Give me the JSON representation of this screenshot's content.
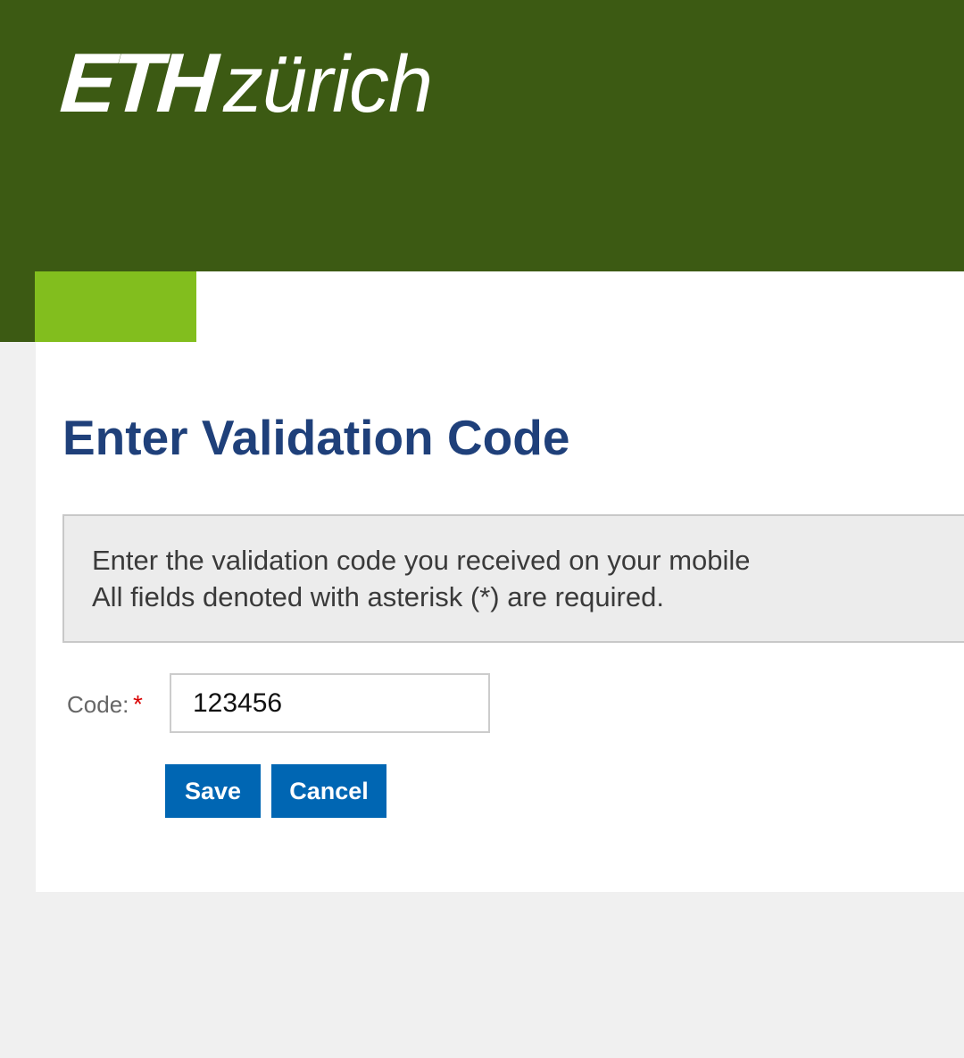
{
  "header": {
    "logo_eth": "ETH",
    "logo_zurich": "zürich",
    "background_color": "#3c5a13",
    "accent_color": "#82be1e"
  },
  "main": {
    "title": "Enter Validation Code",
    "info": {
      "line1": "Enter the validation code you received on your mobile",
      "line2": "All fields denoted with asterisk (*) are required."
    },
    "form": {
      "code_label": "Code:",
      "required_mark": "*",
      "code_value": "123456"
    },
    "buttons": {
      "save_label": "Save",
      "cancel_label": "Cancel",
      "button_color": "#0066b3"
    },
    "title_color": "#1f407a"
  }
}
